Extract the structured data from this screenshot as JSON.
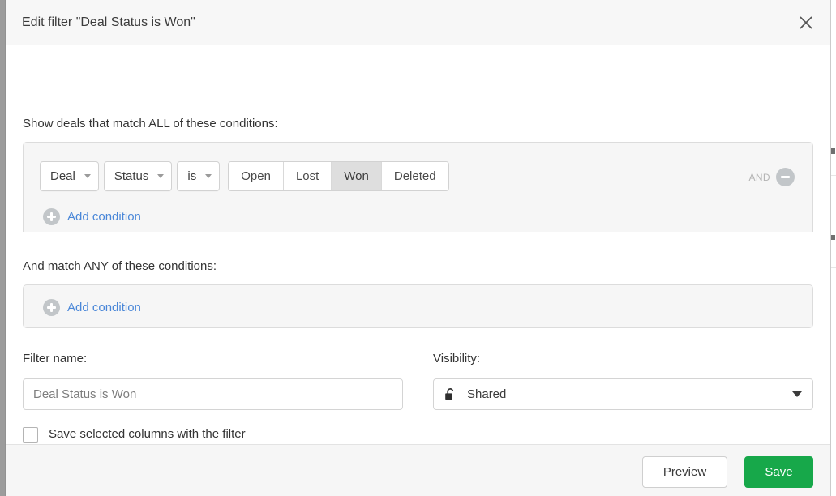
{
  "dialog": {
    "title": "Edit filter \"Deal Status is Won\"",
    "close_icon": "close-icon"
  },
  "sections": {
    "all": {
      "label": "Show deals that match ALL of these conditions:",
      "add_condition_label": "Add condition",
      "condition": {
        "entity": "Deal",
        "field": "Status",
        "operator": "is",
        "values": [
          {
            "label": "Open",
            "selected": false
          },
          {
            "label": "Lost",
            "selected": false
          },
          {
            "label": "Won",
            "selected": true
          },
          {
            "label": "Deleted",
            "selected": false
          }
        ],
        "join_label": "AND",
        "remove_icon": "minus-circle-icon"
      }
    },
    "any": {
      "label": "And match ANY of these conditions:",
      "add_condition_label": "Add condition"
    }
  },
  "form": {
    "filter_name": {
      "label": "Filter name:",
      "value": "",
      "placeholder": "Deal Status is Won"
    },
    "visibility": {
      "label": "Visibility:",
      "value": "Shared",
      "icon": "unlocked-padlock-icon"
    },
    "save_columns_checkbox": {
      "label": "Save selected columns with the filter",
      "checked": false
    }
  },
  "footer": {
    "preview_label": "Preview",
    "save_label": "Save"
  },
  "colors": {
    "accent_green": "#17a84a",
    "link_blue": "#4a87d8",
    "panel_gray": "#f6f6f6",
    "selected_segment": "#dedede"
  }
}
